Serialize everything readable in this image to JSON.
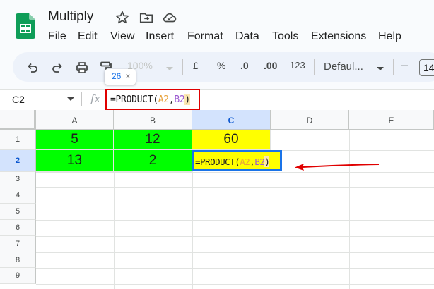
{
  "doc": {
    "title": "Multiply"
  },
  "menu": [
    "File",
    "Edit",
    "View",
    "Insert",
    "Format",
    "Data",
    "Tools",
    "Extensions",
    "Help"
  ],
  "toolbar": {
    "zoom": "100%",
    "currency": "£",
    "percent": "%",
    "dec_decrease": ".0",
    "dec_increase": ".00",
    "num_format": "123",
    "font": "Defaul...",
    "font_size": "14",
    "minus": "–"
  },
  "chip": {
    "label": "26",
    "close": "×"
  },
  "formula_bar": {
    "name_box": "C2",
    "fx": "fx",
    "formula_prefix": "=PRODUCT(",
    "ref1": "A2",
    "comma": ",",
    "ref2": "B2",
    "formula_suffix": ")"
  },
  "columns": [
    "A",
    "B",
    "C",
    "D",
    "E"
  ],
  "rows": [
    "1",
    "2",
    "3",
    "4",
    "5",
    "6",
    "7",
    "8",
    "9"
  ],
  "cells": {
    "A1": "5",
    "B1": "12",
    "C1": "60",
    "A2": "13",
    "B2": "2"
  },
  "active_cell": {
    "prefix": "=PRODUCT(",
    "ref1": "A2",
    "comma": ",",
    "ref2": "B2",
    "suffix": ")"
  },
  "colors": {
    "green_fill": "#00ff00",
    "yellow_fill": "#ffff00",
    "annotation_red": "#e00000",
    "selection_blue": "#1a73e8"
  }
}
